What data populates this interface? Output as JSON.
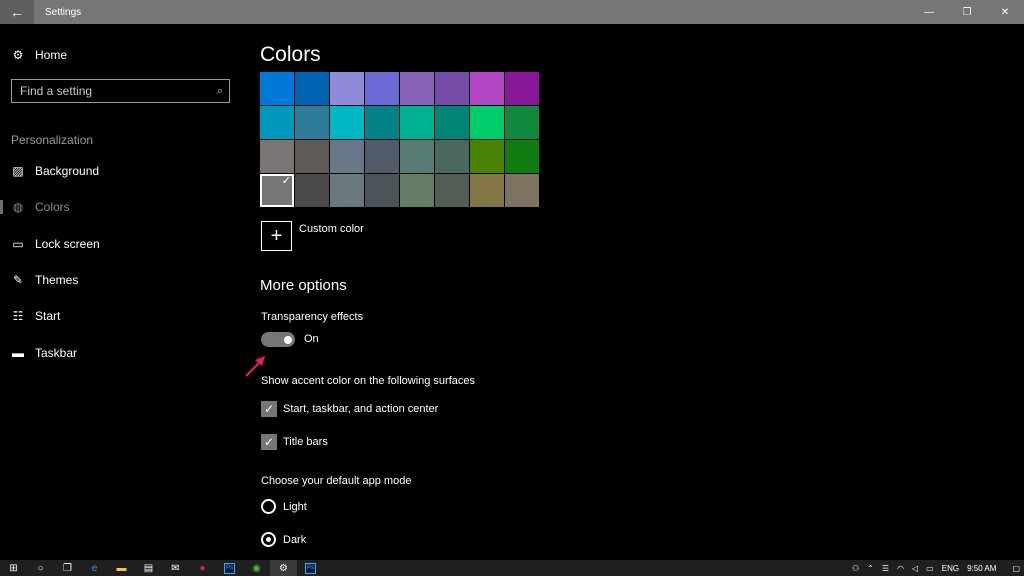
{
  "window": {
    "title": "Settings",
    "back_icon": "back-arrow-icon",
    "minimize": "—",
    "maximize": "❐",
    "close": "✕"
  },
  "sidebar": {
    "home_label": "Home",
    "search_placeholder": "Find a setting",
    "group_label": "Personalization",
    "items": [
      {
        "label": "Background",
        "icon": "picture-icon"
      },
      {
        "label": "Colors",
        "icon": "palette-icon",
        "active": true
      },
      {
        "label": "Lock screen",
        "icon": "lock-screen-icon"
      },
      {
        "label": "Themes",
        "icon": "brush-icon"
      },
      {
        "label": "Start",
        "icon": "start-icon"
      },
      {
        "label": "Taskbar",
        "icon": "taskbar-icon"
      }
    ]
  },
  "main": {
    "heading": "Colors",
    "swatch_colors": [
      "#0078d7",
      "#0063b1",
      "#8e8cd8",
      "#6b69d6",
      "#8764b8",
      "#744da9",
      "#b146c2",
      "#881798",
      "#0099bc",
      "#2d7d9a",
      "#00b7c3",
      "#038387",
      "#00b294",
      "#018574",
      "#00cc6a",
      "#10893e",
      "#7a7574",
      "#5d5a58",
      "#68768a",
      "#515c6b",
      "#567c73",
      "#486860",
      "#498205",
      "#107c10",
      "#767676",
      "#4c4a48",
      "#69797e",
      "#4a5459",
      "#647c64",
      "#525e54",
      "#847545",
      "#7e735f"
    ],
    "selected_swatch_index": 24,
    "custom_color_label": "Custom color",
    "more_options": "More options",
    "transparency_label": "Transparency effects",
    "transparency_state": "On",
    "accent_surfaces_label": "Show accent color on the following surfaces",
    "checkbox_start": "Start, taskbar, and action center",
    "checkbox_title_bars": "Title bars",
    "app_mode_label": "Choose your default app mode",
    "radio_light": "Light",
    "radio_dark": "Dark",
    "app_mode_selected": "Dark"
  },
  "taskbar": {
    "language": "ENG",
    "time": "9:50 AM",
    "ps_label": "Ps"
  },
  "colors": {
    "titlebar": "#767676",
    "background": "#000000",
    "annotation_arrow": "#e8196b"
  }
}
